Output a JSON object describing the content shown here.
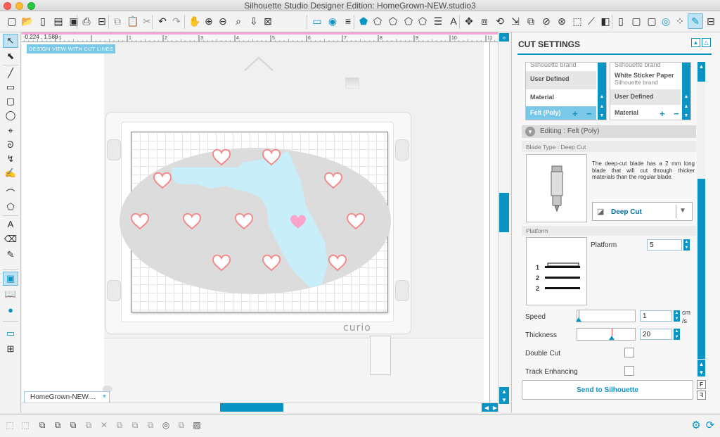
{
  "window": {
    "title": "Silhouette Studio Designer Edition: HomeGrown-NEW.studio3"
  },
  "canvas": {
    "coord_readout": "-0.224 , 1.589",
    "view_label": "DESIGN VIEW WITH CUT LINES",
    "ruler_labels": [
      "-1",
      "1",
      "2",
      "3",
      "4",
      "5",
      "6",
      "7",
      "8",
      "9",
      "10",
      "11"
    ],
    "machine_label": "curio",
    "document_tab": "HomeGrown-NEW....",
    "tab_pin": "⌖"
  },
  "cut_settings": {
    "title": "CUT SETTINGS",
    "left_list": [
      {
        "label": "Silhouette brand",
        "sub": ""
      },
      {
        "label": "User Defined",
        "sub": ""
      },
      {
        "label": "Material",
        "sub": ""
      },
      {
        "label": "Felt (Poly)",
        "sub": ""
      }
    ],
    "right_list": [
      {
        "label": "Silhouette brand",
        "sub": ""
      },
      {
        "label": "White Sticker Paper",
        "sub": "Silhouette brand"
      },
      {
        "label": "User Defined",
        "sub": ""
      },
      {
        "label": "Material",
        "sub": ""
      }
    ],
    "editing_label": "Editing : Felt (Poly)",
    "blade_section": "Blade Type : Deep Cut",
    "blade_description": "The deep-cut blade has a 2 mm long blade that will cut through thicker materials than the regular blade.",
    "blade_select": "Deep Cut",
    "platform_section": "Platform",
    "platform_label": "Platform",
    "platform_value": "5",
    "platform_rows": [
      "1",
      "2",
      "2"
    ],
    "speed_label": "Speed",
    "speed_value": "1",
    "speed_unit": "cm\n/s",
    "speed_level": 0.0,
    "thickness_label": "Thickness",
    "thickness_value": "20",
    "thickness_level": 0.6,
    "double_cut_label": "Double Cut",
    "track_enhancing_label": "Track Enhancing",
    "send_button": "Send to Silhouette"
  },
  "colors": {
    "accent": "#0a94c4",
    "heart": "#f38b8b",
    "heart_fill": "#f9a4c8",
    "florida": "#c8eef9",
    "oval": "#dcdcdc"
  }
}
